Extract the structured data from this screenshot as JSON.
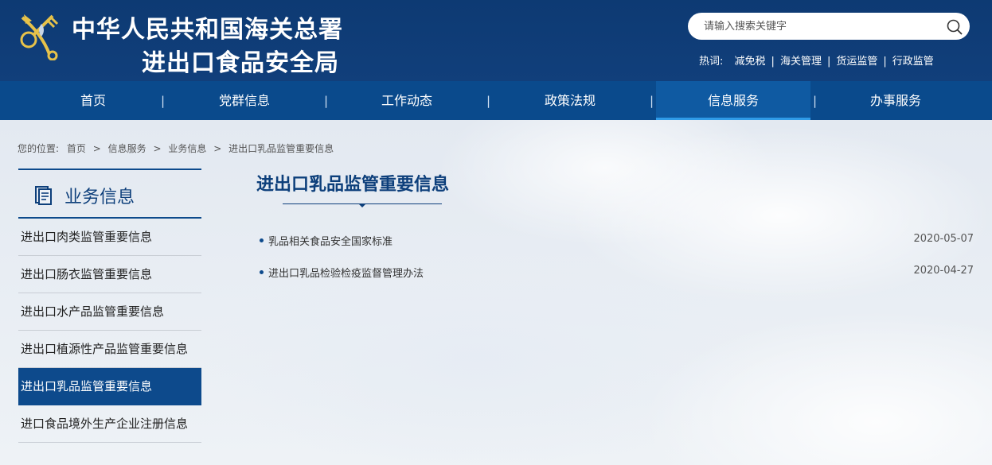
{
  "header": {
    "title_line1": "中华人民共和国海关总署",
    "title_line2": "进出口食品安全局",
    "search": {
      "placeholder": "请输入搜索关键字"
    },
    "hotwords_label": "热词:",
    "hotwords": [
      "减免税",
      "海关管理",
      "货运监管",
      "行政监管"
    ]
  },
  "nav": {
    "items": [
      "首页",
      "党群信息",
      "工作动态",
      "政策法规",
      "信息服务",
      "办事服务"
    ],
    "active": "信息服务"
  },
  "breadcrumb": {
    "label": "您的位置:",
    "items": [
      "首页",
      "信息服务",
      "业务信息",
      "进出口乳品监管重要信息"
    ],
    "separator": ">"
  },
  "sidebar": {
    "title": "业务信息",
    "items": [
      "进出口肉类监管重要信息",
      "进出口肠衣监管重要信息",
      "进出口水产品监管重要信息",
      "进出口植源性产品监管重要信息",
      "进出口乳品监管重要信息",
      "进口食品境外生产企业注册信息"
    ],
    "active": "进出口乳品监管重要信息"
  },
  "main": {
    "title": "进出口乳品监管重要信息",
    "articles": [
      {
        "title": "乳品相关食品安全国家标准",
        "date": "2020-05-07"
      },
      {
        "title": "进出口乳品检验检疫监督管理办法",
        "date": "2020-04-27"
      }
    ]
  },
  "colors": {
    "header_bg": "#0d3a73",
    "nav_bg": "#0a4a8c",
    "accent": "#0d4a8c",
    "title_color": "#0d3f7b"
  }
}
